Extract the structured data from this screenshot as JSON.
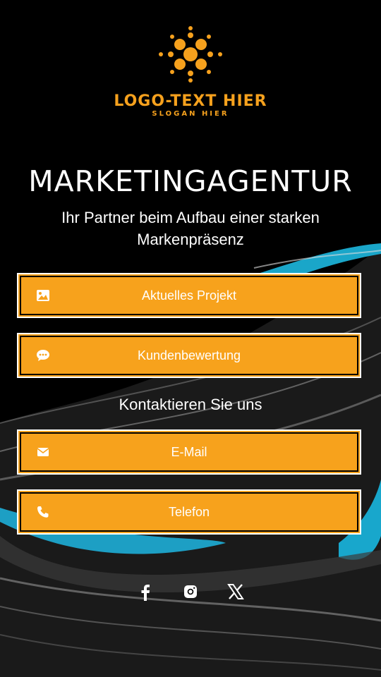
{
  "brand": {
    "logo_text": "LOGO-TEXT HIER",
    "slogan": "SLOGAN HIER",
    "accent_color": "#f7a21c",
    "logo_icon": "cross-dots-icon"
  },
  "hero": {
    "title": "MARKETINGAGENTUR",
    "subtitle": "Ihr Partner beim Aufbau einer starken Markenpräsenz"
  },
  "buttons": [
    {
      "label": "Aktuelles Projekt",
      "icon": "image-icon"
    },
    {
      "label": "Kundenbewertung",
      "icon": "chat-bubble-icon"
    }
  ],
  "contact": {
    "heading": "Kontaktieren Sie uns",
    "buttons": [
      {
        "label": "E-Mail",
        "icon": "envelope-icon"
      },
      {
        "label": "Telefon",
        "icon": "phone-icon"
      }
    ]
  },
  "social": [
    {
      "icon": "facebook-icon"
    },
    {
      "icon": "instagram-icon"
    },
    {
      "icon": "x-icon"
    }
  ]
}
